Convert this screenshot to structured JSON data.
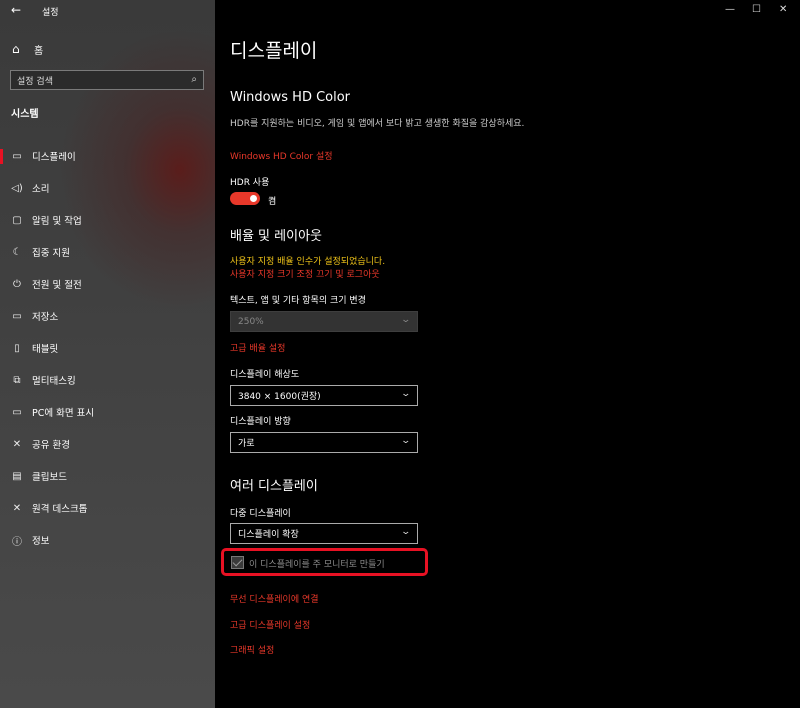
{
  "titlebar": {
    "title": "설정",
    "back": "←",
    "minimize": "—",
    "maximize": "☐",
    "close": "✕"
  },
  "sidebar": {
    "home": {
      "label": "홈",
      "icon": "home-icon"
    },
    "search": {
      "placeholder": "설정 검색",
      "icon": "search-icon"
    },
    "section": "시스템",
    "items": [
      {
        "label": "디스플레이",
        "icon": "monitor-icon",
        "glyph": "▭",
        "active": true
      },
      {
        "label": "소리",
        "icon": "speaker-icon",
        "glyph": "◁)"
      },
      {
        "label": "알림 및 작업",
        "icon": "notification-icon",
        "glyph": "▢"
      },
      {
        "label": "집중 지원",
        "icon": "moon-icon",
        "glyph": "☾"
      },
      {
        "label": "전원 및 절전",
        "icon": "power-icon",
        "glyph": "⏻"
      },
      {
        "label": "저장소",
        "icon": "storage-icon",
        "glyph": "▭"
      },
      {
        "label": "태블릿",
        "icon": "tablet-icon",
        "glyph": "▯"
      },
      {
        "label": "멀티태스킹",
        "icon": "multitasking-icon",
        "glyph": "⧉"
      },
      {
        "label": "PC에 화면 표시",
        "icon": "project-icon",
        "glyph": "▭"
      },
      {
        "label": "공유 환경",
        "icon": "share-icon",
        "glyph": "✕"
      },
      {
        "label": "클립보드",
        "icon": "clipboard-icon",
        "glyph": "▤"
      },
      {
        "label": "원격 데스크톱",
        "icon": "remote-desktop-icon",
        "glyph": "✕"
      },
      {
        "label": "정보",
        "icon": "info-icon",
        "glyph": "ⓘ"
      }
    ]
  },
  "main": {
    "title": "디스플레이",
    "hdr": {
      "heading": "Windows HD Color",
      "desc": "HDR를 지원하는 비디오, 게임 및 앱에서 보다 밝고 생생한 화질을 감상하세요.",
      "link": "Windows HD Color 설정",
      "toggle_label": "HDR 사용",
      "toggle_state": "켬"
    },
    "scale": {
      "heading": "배율 및 레이아웃",
      "warning1": "사용자 지정 배율 인수가 설정되었습니다.",
      "warning2": "사용자 지정 크기 조정 끄기 및 로그아웃",
      "size_label": "텍스트, 앱 및 기타 항목의 크기 변경",
      "size_value": "250%",
      "advanced_link": "고급 배율 설정",
      "resolution_label": "디스플레이 해상도",
      "resolution_value": "3840 × 1600(권장)",
      "orientation_label": "디스플레이 방향",
      "orientation_value": "가로"
    },
    "multi": {
      "heading": "여러 디스플레이",
      "label": "다중 디스플레이",
      "value": "디스플레이 확장",
      "checkbox_label": "이 디스플레이를 주 모니터로 만들기",
      "checkbox_checked": true,
      "link_wireless": "무선 디스플레이에 연결",
      "link_advanced": "고급 디스플레이 설정",
      "link_graphics": "그래픽 설정"
    }
  },
  "colors": {
    "accent": "#e8382a",
    "warning": "#f0c419",
    "highlight": "#e81123"
  }
}
